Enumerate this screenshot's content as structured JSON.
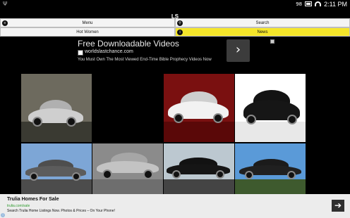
{
  "status_bar": {
    "usb_icon": "usb-icon",
    "battery_percent": "98",
    "time": "2:11 PM"
  },
  "app": {
    "title": "LS"
  },
  "menu": {
    "items": [
      {
        "label": "Menu",
        "icon": "list-icon",
        "active": false
      },
      {
        "label": "Search",
        "icon": "search-icon",
        "active": false
      },
      {
        "label": "Hot Women",
        "icon": "",
        "active": false
      },
      {
        "label": "News",
        "icon": "info-icon",
        "active": true
      }
    ]
  },
  "ad": {
    "title": "Free Downloadable Videos",
    "url": "worldslastchance.com",
    "description": "You Must Own The Most Viewed End-Time Bible Prophecy Videos Now",
    "arrow": "›"
  },
  "photos": [
    {
      "alt": "silver sedan in front of building",
      "bg": "#6d6a5e",
      "car": "#cfcfcf"
    },
    {
      "alt": "",
      "bg": "#000000",
      "car": ""
    },
    {
      "alt": "red studio car",
      "bg": "#7a1010",
      "car": "#f2f2f2"
    },
    {
      "alt": "black sedan rear on white",
      "bg": "#ffffff",
      "car": "#161616"
    },
    {
      "alt": "grey car near bridge",
      "bg": "#7da6d6",
      "car": "#5c5c5c"
    },
    {
      "alt": "silver car on grey",
      "bg": "#8b8b8b",
      "car": "#c3c3c3"
    },
    {
      "alt": "black car by glass building",
      "bg": "#bcc8d0",
      "car": "#151515"
    },
    {
      "alt": "dark car in front of mansion",
      "bg": "#5a9ad8",
      "car": "#202020"
    }
  ],
  "bottom_ad": {
    "title": "Trulia Homes For Sale",
    "url": "trulia.com/sale",
    "description": "Search Trulia Home Listings Now. Photos & Prices – On Your Phone!",
    "arrow": "➔",
    "info": "i"
  }
}
